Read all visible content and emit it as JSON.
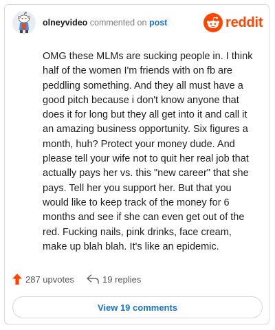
{
  "header": {
    "username": "olneyvideo",
    "action_text": " commented on ",
    "post_link": "post",
    "brand_name": "reddit",
    "avatar_icon": "snoo-avatar-icon",
    "brand_icon": "reddit-logo-icon"
  },
  "comment": {
    "body": "OMG these MLMs are sucking people in. I think half of the women I'm friends with on fb are peddling something. And they all must have a good pitch because i don't know anyone that does it for long but they all get into it and call it an amazing business opportunity. Six figures a month, huh? Protect your money dude. And please tell your wife not to quit her real job that actually pays her vs. this \"new career\" that she pays. Tell her you support her. But that you would like to keep track of the money for 6 months and see if she can even get out of the red. Fucking nails, pink drinks, face cream, make up blah blah. It's like an epidemic."
  },
  "stats": {
    "upvotes_label": "287 upvotes",
    "replies_label": "19 replies",
    "upvote_icon": "upvote-arrow-icon",
    "reply_icon": "reply-arrow-icon"
  },
  "actions": {
    "view_comments_label": "View 19 comments"
  },
  "colors": {
    "brand_orange": "#ff4500",
    "link_blue": "#1a73c7",
    "upvote_orange": "#ff4500"
  }
}
